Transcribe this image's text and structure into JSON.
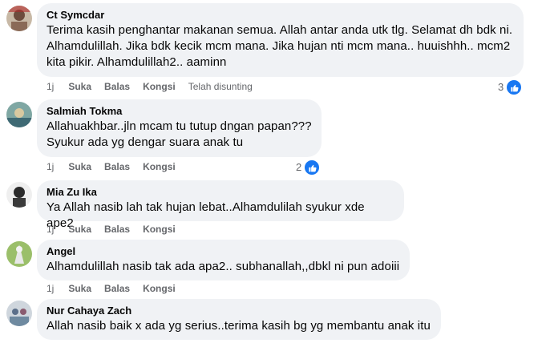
{
  "comments": [
    {
      "name": "Ct Symcdar",
      "lines": [
        "Terima kasih penghantar makanan semua. Allah antar anda utk tlg. Selamat dh bdk ni.",
        "Alhamdulillah. Jika bdk kecik mcm mana. Jika hujan nti mcm mana.. huuishhh.. mcm2",
        "kita pikir. Alhamdulillah2.. aaminn"
      ],
      "age": "1j",
      "like": "Suka",
      "reply": "Balas",
      "share": "Kongsi",
      "extra": "Telah disunting",
      "reactions": "3"
    },
    {
      "name": "Salmiah Tokma",
      "lines": [
        "Allahuakhbar..jln mcam tu tutup dngan papan???",
        "Syukur ada yg dengar suara anak tu"
      ],
      "age": "1j",
      "like": "Suka",
      "reply": "Balas",
      "share": "Kongsi",
      "reactions": "2"
    },
    {
      "name": "Mia Zu Ika",
      "lines": [
        "Ya Allah nasib lah tak hujan lebat..Alhamdulilah syukur xde ape2"
      ],
      "age": "1j",
      "like": "Suka",
      "reply": "Balas",
      "share": "Kongsi"
    },
    {
      "name": "Angel",
      "lines": [
        "Alhamdulillah nasib tak ada apa2.. subhanallah,,dbkl ni pun adoiii"
      ],
      "age": "1j",
      "like": "Suka",
      "reply": "Balas",
      "share": "Kongsi"
    },
    {
      "name": "Nur Cahaya Zach",
      "lines": [
        "Allah nasib baik x ada yg serius..terima kasih bg yg membantu anak itu"
      ]
    }
  ],
  "icons": {
    "like": "thumbs-up-icon"
  },
  "colors": {
    "bubble": "#f0f2f5",
    "meta": "#65676b",
    "accent": "#1877f2"
  }
}
